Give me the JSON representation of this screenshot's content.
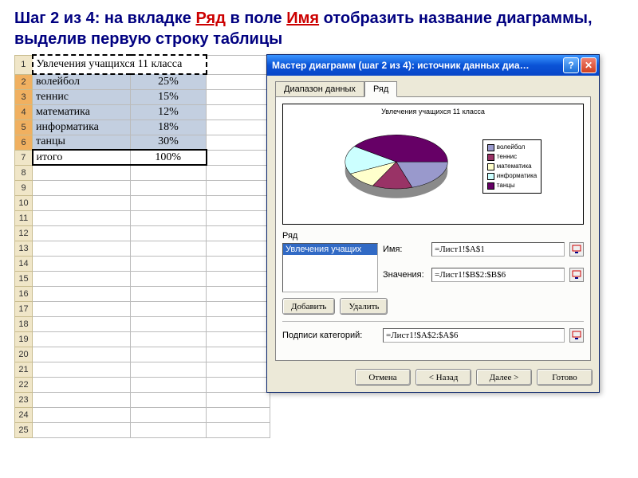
{
  "instruction": {
    "prefix": "Шаг 2 из 4: ",
    "p1": "на вкладке ",
    "kw1": "Ряд",
    "p2": " в поле ",
    "kw2": "Имя",
    "p3": " отобразить название диаграммы, выделив первую строку таблицы"
  },
  "sheet": {
    "rows": [
      {
        "n": "1",
        "a": "Увлечения учащихся 11 класса",
        "b": ""
      },
      {
        "n": "2",
        "a": "волейбол",
        "b": "25%"
      },
      {
        "n": "3",
        "a": "теннис",
        "b": "15%"
      },
      {
        "n": "4",
        "a": "математика",
        "b": "12%"
      },
      {
        "n": "5",
        "a": "информатика",
        "b": "18%"
      },
      {
        "n": "6",
        "a": "танцы",
        "b": "30%"
      },
      {
        "n": "7",
        "a": "итого",
        "b": "100%"
      }
    ]
  },
  "dialog": {
    "title": "Мастер диаграмм (шаг 2 из 4): источник данных диа…",
    "tabs": {
      "range": "Диапазон данных",
      "series": "Ряд"
    },
    "chart_title": "Увлечения учащихся 11 класса",
    "legend": [
      "волейбол",
      "теннис",
      "математика",
      "информатика",
      "танцы"
    ],
    "series_label": "Ряд",
    "series_item": "Увлечения учащих",
    "name_label": "Имя:",
    "name_value": "=Лист1!$A$1",
    "values_label": "Значения:",
    "values_value": "=Лист1!$B$2:$B$6",
    "add": "Добавить",
    "remove": "Удалить",
    "catlabels_label": "Подписи категорий:",
    "catlabels_value": "=Лист1!$A$2:$A$6",
    "cancel": "Отмена",
    "back": "< Назад",
    "next": "Далее >",
    "finish": "Готово"
  },
  "chart_data": {
    "type": "pie",
    "title": "Увлечения учащихся 11 класса",
    "categories": [
      "волейбол",
      "теннис",
      "математика",
      "информатика",
      "танцы"
    ],
    "values": [
      25,
      15,
      12,
      18,
      30
    ],
    "colors": [
      "#9999cc",
      "#993366",
      "#ffffcc",
      "#ccffff",
      "#660066"
    ]
  }
}
